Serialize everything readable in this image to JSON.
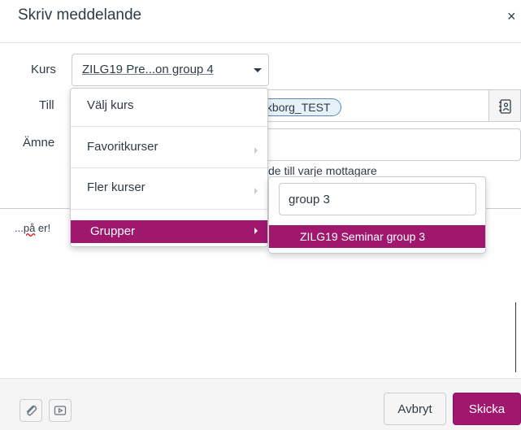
{
  "dialog": {
    "title": "Skriv meddelande",
    "close_label": "×"
  },
  "form": {
    "course_label": "Kurs",
    "course_value": "ZILG19 Pre...on group 4",
    "to_label": "Till",
    "recipient": "uta Drakborg_TEST",
    "subject_label": "Ämne",
    "individual_message_label": "de till varje mottagare"
  },
  "course_menu": {
    "items": [
      {
        "label": "Välj kurs"
      },
      {
        "label": "Favoritkurser"
      },
      {
        "label": "Fler kurser"
      },
      {
        "label": "Grupper"
      }
    ]
  },
  "groups_submenu": {
    "search_value": "group 3",
    "results": [
      {
        "label": "ZILG19 Seminar group 3"
      }
    ]
  },
  "body": {
    "text_prefix": "...",
    "text_misspelled": "på",
    "text_suffix": " er!"
  },
  "footer": {
    "cancel_label": "Avbryt",
    "send_label": "Skicka"
  },
  "colors": {
    "accent": "#a0186e",
    "text": "#2d3b45",
    "border": "#c7cdd1"
  },
  "icons": [
    "close-icon",
    "caret-down-icon",
    "address-book-icon",
    "paperclip-icon",
    "media-icon",
    "chevron-right-icon"
  ]
}
